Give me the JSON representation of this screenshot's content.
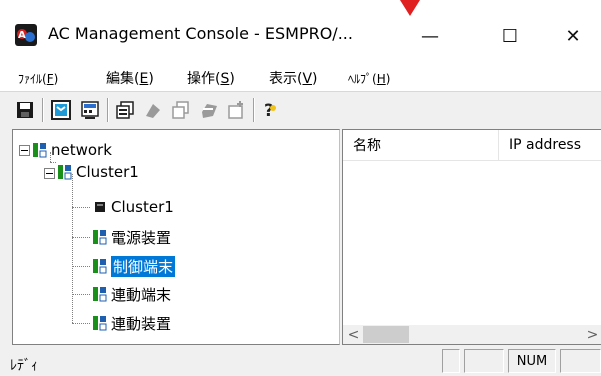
{
  "window": {
    "title": "AC Management Console - ESMPRO/...",
    "controls": {
      "minimize": "—",
      "maximize": "☐",
      "close": "✕"
    }
  },
  "menu": [
    {
      "label": "ﾌｧｲﾙ(",
      "key": "F",
      "tail": ")"
    },
    {
      "label": "編集(",
      "key": "E",
      "tail": ")"
    },
    {
      "label": "操作(",
      "key": "S",
      "tail": ")"
    },
    {
      "label": "表示(",
      "key": "V",
      "tail": ")"
    },
    {
      "label": "ﾍﾙﾌﾟ(",
      "key": "H",
      "tail": ")"
    }
  ],
  "toolbar": {
    "buttons": [
      "save-icon",
      "network-view-icon",
      "device-view-icon",
      "properties-icon",
      "power-on-icon",
      "power-off-icon",
      "restart-icon",
      "add-icon",
      "help-icon"
    ]
  },
  "tree": {
    "root": "network",
    "cluster": "Cluster1",
    "children": [
      "Cluster1",
      "電源装置",
      "制御端末",
      "連動端末",
      "連動装置"
    ],
    "selected_index": 2
  },
  "list": {
    "columns": [
      "名称",
      "IP address"
    ]
  },
  "status": {
    "text": "ﾚﾃﾞｨ",
    "num": "NUM"
  },
  "colors": {
    "selection": "#0078d7",
    "node_green": "#1a8f1a",
    "node_blue": "#1e5fb0",
    "arrow_red": "#e02020"
  }
}
